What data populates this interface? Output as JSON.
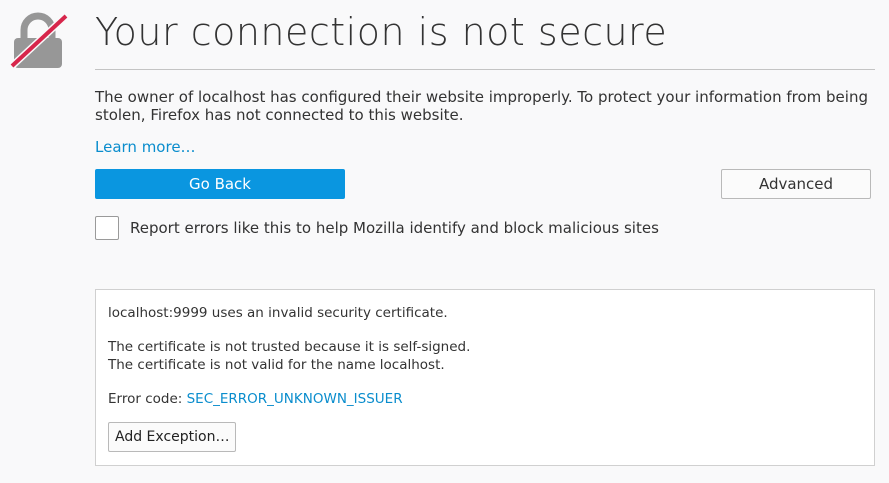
{
  "header": {
    "title": "Your connection is not secure"
  },
  "main": {
    "description": "The owner of localhost has configured their website improperly. To protect your information from being stolen, Firefox has not connected to this website.",
    "learn_more": "Learn more…",
    "go_back_label": "Go Back",
    "advanced_label": "Advanced",
    "report_checkbox_checked": false,
    "report_label": "Report errors like this to help Mozilla identify and block malicious sites"
  },
  "advanced_panel": {
    "line1": "localhost:9999 uses an invalid security certificate.",
    "line2": "The certificate is not trusted because it is self-signed.",
    "line3": "The certificate is not valid for the name localhost.",
    "error_code_prefix": "Error code: ",
    "error_code": "SEC_ERROR_UNKNOWN_ISSUER",
    "add_exception_label": "Add Exception…"
  },
  "colors": {
    "primary_button": "#0a96e0",
    "link": "#0a8dcd",
    "lock_gray": "#979797",
    "strike_red": "#d7264b",
    "background": "#f9f9fa"
  },
  "icons": {
    "lock": "lock-broken-icon"
  }
}
